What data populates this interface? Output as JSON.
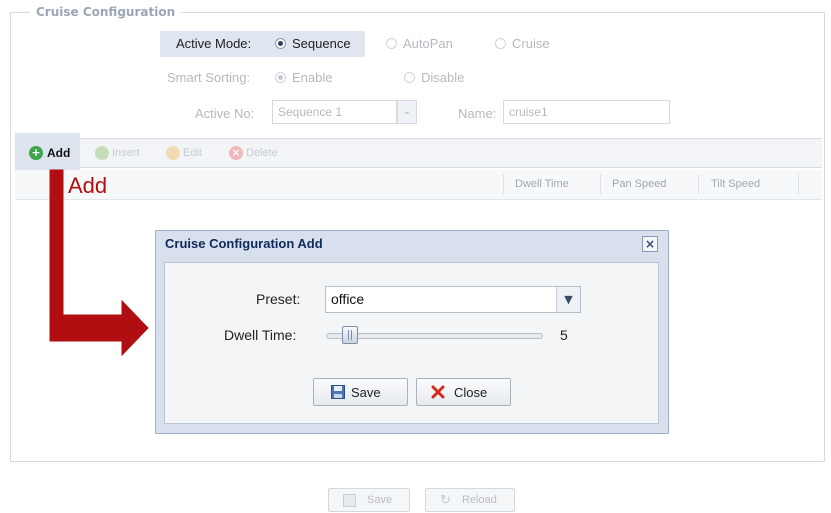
{
  "panel": {
    "legend": "Cruise Configuration"
  },
  "active_mode": {
    "label": "Active Mode:",
    "options": [
      {
        "label": "Sequence",
        "selected": true
      },
      {
        "label": "AutoPan",
        "selected": false
      },
      {
        "label": "Cruise",
        "selected": false
      }
    ]
  },
  "smart_sorting": {
    "label": "Smart Sorting:",
    "options": [
      {
        "label": "Enable",
        "selected": true
      },
      {
        "label": "Disable",
        "selected": false
      }
    ]
  },
  "active_no": {
    "label": "Active No:",
    "value": "Sequence 1"
  },
  "name_field": {
    "label": "Name:",
    "value": "cruise1"
  },
  "toolbar": {
    "add": "Add",
    "insert": "Insert",
    "edit": "Edit",
    "delete": "Delete"
  },
  "grid": {
    "columns": [
      "Dwell Time",
      "Pan Speed",
      "Tilt Speed"
    ]
  },
  "annotation": {
    "text": "Add",
    "color": "#b10e12"
  },
  "dialog": {
    "title": "Cruise Configuration Add",
    "preset_label": "Preset:",
    "preset_value": "office",
    "dwell_label": "Dwell Time:",
    "dwell_value": "5",
    "save": "Save",
    "close": "Close"
  },
  "footer": {
    "save": "Save",
    "reload": "Reload"
  },
  "icons": [
    "add-icon",
    "insert-icon",
    "edit-icon",
    "delete-icon",
    "close-icon",
    "save-icon",
    "x-icon",
    "reload-icon",
    "chevron-down-icon"
  ]
}
